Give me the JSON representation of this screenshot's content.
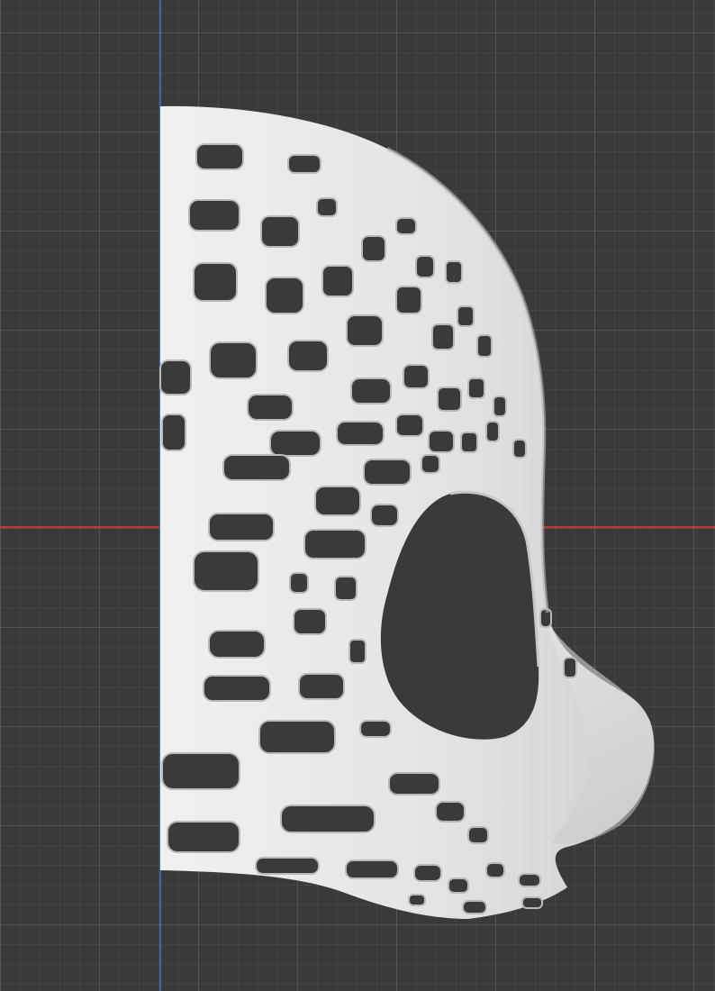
{
  "viewport": {
    "grid_visible": true,
    "background_color": "#3a3a3a",
    "axis_x_color": "#b53b3b",
    "axis_z_color": "#3c6aa8"
  },
  "model": {
    "kind": "half-mask-lattice",
    "surface_color": "#e6e6e6",
    "shadow_color": "#b8b8b8",
    "hole_color": "#3a3a3a"
  }
}
